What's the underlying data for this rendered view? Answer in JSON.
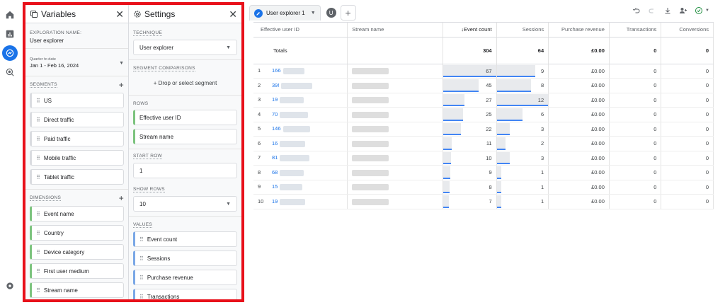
{
  "rail": {
    "icons": [
      "home-icon",
      "reports-icon",
      "explore-icon",
      "advertising-icon",
      "settings-icon"
    ]
  },
  "variables_panel": {
    "title": "Variables",
    "exploration_name_label": "EXPLORATION NAME:",
    "exploration_name": "User explorer",
    "date_range_label": "Quarter to date",
    "date_range_value": "Jan 1 - Feb 16, 2024",
    "segments_label": "SEGMENTS",
    "segments": [
      "US",
      "Direct traffic",
      "Paid traffic",
      "Mobile traffic",
      "Tablet traffic"
    ],
    "dimensions_label": "DIMENSIONS",
    "dimensions": [
      "Event name",
      "Country",
      "Device category",
      "First user medium",
      "Stream name"
    ]
  },
  "settings_panel": {
    "title": "Settings",
    "technique_label": "TECHNIQUE",
    "technique_value": "User explorer",
    "segment_comparisons_label": "SEGMENT COMPARISONS",
    "drop_segment_text": "+ Drop or select segment",
    "rows_label": "ROWS",
    "rows": [
      "Effective user ID",
      "Stream name"
    ],
    "start_row_label": "START ROW",
    "start_row_value": "1",
    "show_rows_label": "SHOW ROWS",
    "show_rows_value": "10",
    "values_label": "VALUES",
    "values": [
      "Event count",
      "Sessions",
      "Purchase revenue",
      "Transactions"
    ]
  },
  "tabs": {
    "active_label": "User explorer 1",
    "badge": "U",
    "add": "+"
  },
  "table": {
    "columns": [
      "Effective user ID",
      "Stream name",
      "↓Event count",
      "Sessions",
      "Purchase revenue",
      "Transactions",
      "Conversions"
    ],
    "totals": {
      "label": "Totals",
      "event_count": "304",
      "sessions": "64",
      "purchase_revenue": "£0.00",
      "transactions": "0",
      "conversions": "0"
    },
    "rows": [
      {
        "n": "1",
        "uid": "166",
        "events": 67,
        "sessions": 9,
        "revenue": "£0.00",
        "transactions": "0",
        "conversions": "0"
      },
      {
        "n": "2",
        "uid": "39!",
        "events": 45,
        "sessions": 8,
        "revenue": "£0.00",
        "transactions": "0",
        "conversions": "0"
      },
      {
        "n": "3",
        "uid": "19",
        "events": 27,
        "sessions": 12,
        "revenue": "£0.00",
        "transactions": "0",
        "conversions": "0"
      },
      {
        "n": "4",
        "uid": "70",
        "events": 25,
        "sessions": 6,
        "revenue": "£0.00",
        "transactions": "0",
        "conversions": "0"
      },
      {
        "n": "5",
        "uid": "146",
        "events": 22,
        "sessions": 3,
        "revenue": "£0.00",
        "transactions": "0",
        "conversions": "0"
      },
      {
        "n": "6",
        "uid": "16",
        "events": 11,
        "sessions": 2,
        "revenue": "£0.00",
        "transactions": "0",
        "conversions": "0"
      },
      {
        "n": "7",
        "uid": "81",
        "events": 10,
        "sessions": 3,
        "revenue": "£0.00",
        "transactions": "0",
        "conversions": "0"
      },
      {
        "n": "8",
        "uid": "68",
        "events": 9,
        "sessions": 1,
        "revenue": "£0.00",
        "transactions": "0",
        "conversions": "0"
      },
      {
        "n": "9",
        "uid": "15",
        "events": 8,
        "sessions": 1,
        "revenue": "£0.00",
        "transactions": "0",
        "conversions": "0"
      },
      {
        "n": "10",
        "uid": "19",
        "events": 7,
        "sessions": 1,
        "revenue": "£0.00",
        "transactions": "0",
        "conversions": "0"
      }
    ]
  },
  "colors": {
    "accent": "#1a73e8",
    "highlight": "#e8101a",
    "dimension": "#7cc37e",
    "metric": "#7aa7e6"
  }
}
